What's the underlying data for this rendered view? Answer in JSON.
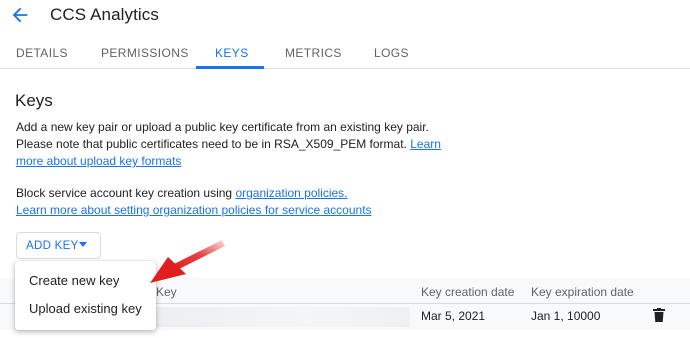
{
  "header": {
    "title": "CCS Analytics"
  },
  "tabs": [
    {
      "label": "DETAILS"
    },
    {
      "label": "PERMISSIONS"
    },
    {
      "label": "KEYS"
    },
    {
      "label": "METRICS"
    },
    {
      "label": "LOGS"
    }
  ],
  "active_tab": "KEYS",
  "keys": {
    "title": "Keys",
    "para1_text": "Add a new key pair or upload a public key certificate from an existing key pair. Please note that public certificates need to be in RSA_X509_PEM format.",
    "para1_link": "Learn more about upload key formats",
    "para2_text": "Block service account key creation using",
    "para2_link1": "organization policies.",
    "para2_link2": "Learn more about setting organization policies for service accounts",
    "add_key_label": "ADD KEY"
  },
  "menu": {
    "items": [
      {
        "label": "Create new key"
      },
      {
        "label": "Upload existing key"
      }
    ]
  },
  "table": {
    "headers": [
      "Key",
      "Key creation date",
      "Key expiration date"
    ],
    "rows": [
      {
        "key": "",
        "created": "Mar 5, 2021",
        "expires": "Jan 1, 10000"
      }
    ]
  },
  "colors": {
    "accent": "#1a73e8",
    "annotation_arrow": "#e02020"
  },
  "icons": {
    "back": "arrow-back-icon",
    "delete": "trash-icon",
    "dropdown": "caret-down-icon"
  }
}
